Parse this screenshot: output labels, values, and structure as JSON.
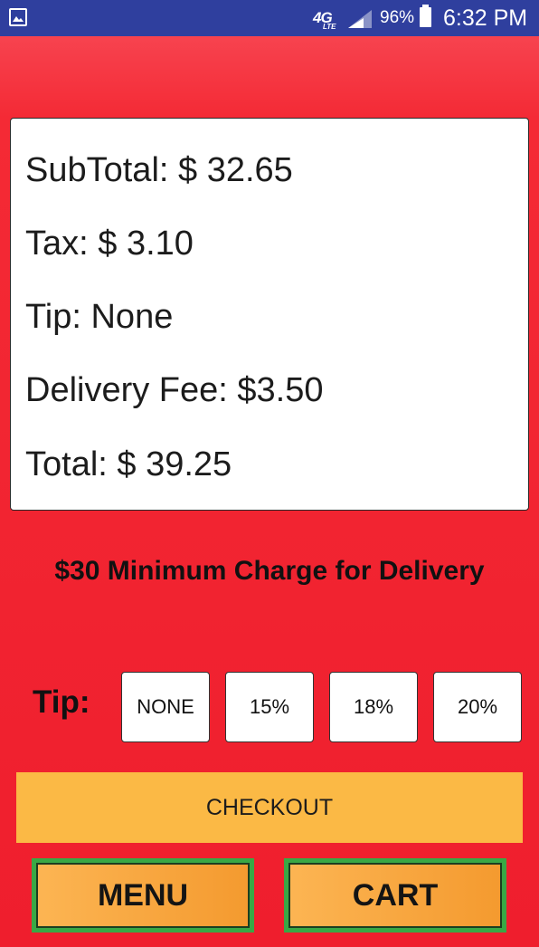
{
  "status_bar": {
    "network_type": "4G",
    "network_sub": "LTE",
    "battery_percent": "96%",
    "time": "6:32 PM",
    "icons": [
      "image-icon",
      "signal-icon",
      "battery-icon"
    ],
    "background_color": "#2f3f9e"
  },
  "summary": {
    "subtotal": "SubTotal: $ 32.65",
    "tax": "Tax: $ 3.10",
    "tip": "Tip: None",
    "delivery_fee": "Delivery Fee: $3.50",
    "total": "Total: $ 39.25"
  },
  "minimum_charge_notice": "$30 Minimum Charge for Delivery",
  "tip_selector": {
    "label": "Tip:",
    "options": [
      "NONE",
      "15%",
      "18%",
      "20%"
    ]
  },
  "checkout_label": "CHECKOUT",
  "nav": {
    "menu_label": "MENU",
    "cart_label": "CART"
  },
  "colors": {
    "background": "#f42a35",
    "checkout": "#fbb945",
    "nav_border": "#39a845",
    "nav_fill": "#f49a2f"
  }
}
